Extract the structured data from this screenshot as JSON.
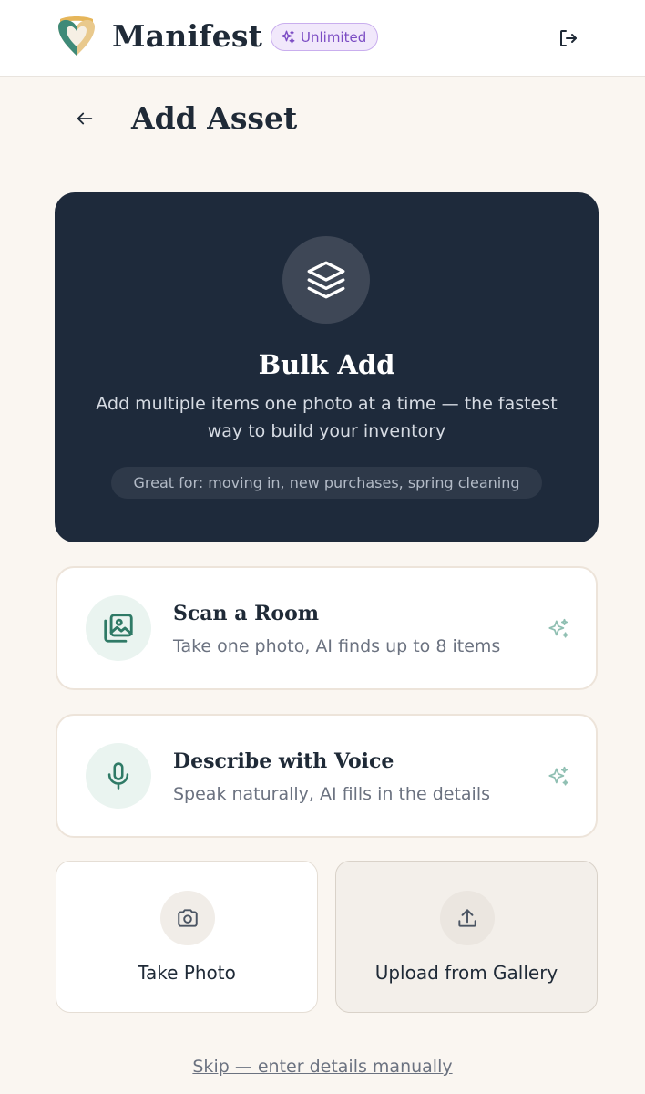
{
  "header": {
    "brand": "Manifest",
    "badge": "Unlimited",
    "logo_icon": "heart-shield-logo-icon",
    "logout_icon": "logout-icon"
  },
  "page": {
    "title": "Add Asset",
    "back_icon": "arrow-left-icon"
  },
  "bulk_add": {
    "icon": "layers-icon",
    "title": "Bulk Add",
    "description": "Add multiple items one photo at a time — the fastest way to build your inventory",
    "chip": "Great for: moving in, new purchases, spring cleaning"
  },
  "options": [
    {
      "icon": "image-gallery-icon",
      "title": "Scan a Room",
      "subtitle": "Take one photo, AI finds up to 8 items"
    },
    {
      "icon": "microphone-icon",
      "title": "Describe with Voice",
      "subtitle": "Speak naturally, AI fills in the details"
    }
  ],
  "tiles": [
    {
      "icon": "camera-icon",
      "label": "Take Photo"
    },
    {
      "icon": "upload-icon",
      "label": "Upload from Gallery"
    }
  ],
  "skip_link": "Skip — enter details manually",
  "colors": {
    "background": "#faf6f1",
    "navy": "#1e2a3b",
    "accent_teal": "#2f7a66",
    "badge_purple": "#7c4dc4"
  }
}
